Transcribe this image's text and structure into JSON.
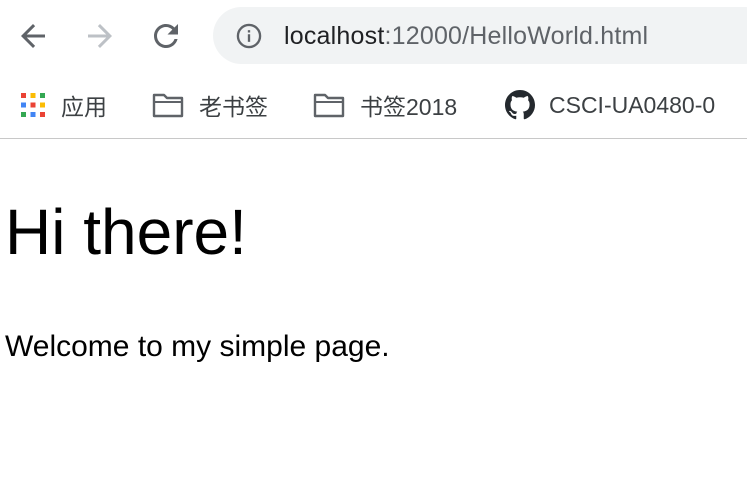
{
  "browser": {
    "url_host": "localhost",
    "url_path": ":12000/HelloWorld.html",
    "bookmarks": [
      {
        "label": "应用",
        "icon": "apps-grid-icon"
      },
      {
        "label": "老书签",
        "icon": "folder-icon"
      },
      {
        "label": "书签2018",
        "icon": "folder-icon"
      },
      {
        "label": "CSCI-UA0480-0",
        "icon": "github-icon"
      }
    ]
  },
  "page": {
    "heading": "Hi there!",
    "paragraph": "Welcome to my simple page."
  },
  "colors": {
    "toolbar_bg": "#ffffff",
    "omnibox_bg": "#f1f3f4",
    "text_primary": "#202124",
    "text_secondary": "#5f6368",
    "disabled_icon": "#bdc1c6"
  }
}
